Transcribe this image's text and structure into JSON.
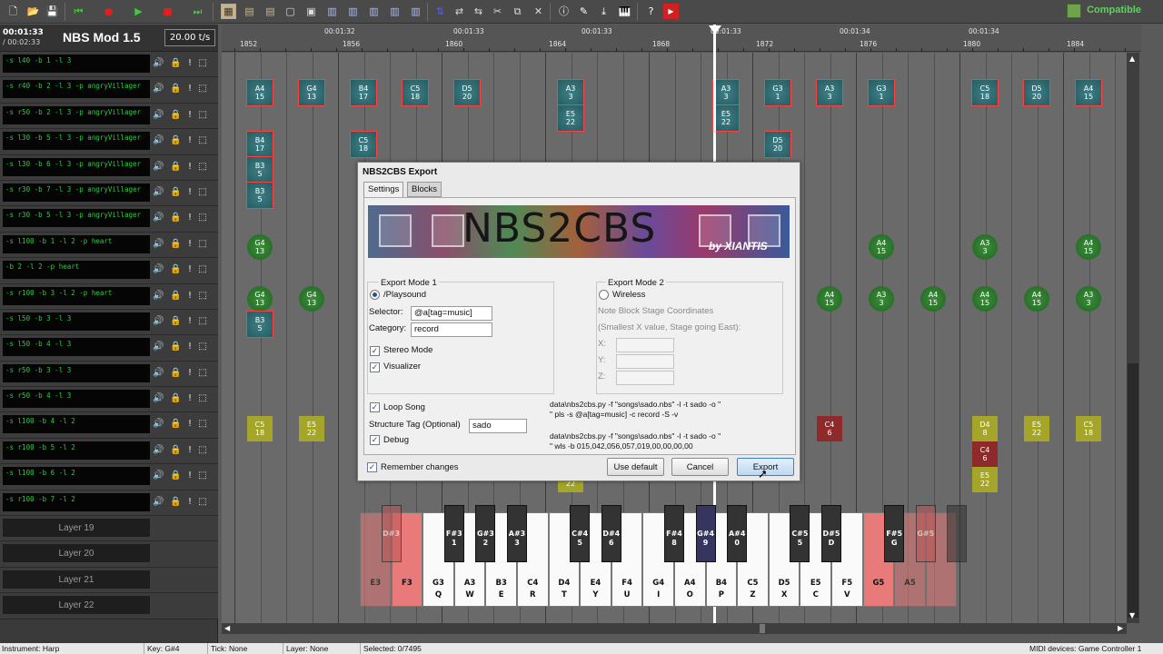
{
  "app": {
    "compatibility": "Compatible"
  },
  "toolbar": {
    "buttons": [
      "new-file",
      "open-file",
      "save-file",
      "skip-back",
      "record",
      "play",
      "stop",
      "skip-forward",
      "select-all",
      "select-left",
      "select-right",
      "select-none",
      "clear",
      "invert",
      "cut-copy",
      "paste",
      "transpose",
      "expand",
      "compress",
      "cut",
      "copy",
      "delete",
      "info",
      "edit",
      "export-midi",
      "piano",
      "help",
      "youtube"
    ]
  },
  "song": {
    "current_time": "00:01:33",
    "total_time": "/ 00:02:33",
    "title": "NBS Mod 1.5",
    "tempo": "20.00 t/s"
  },
  "layers": [
    {
      "name": "-s l40 -b 1 -l 3"
    },
    {
      "name": "-s r40 -b 2 -l 3 -p angryVillager"
    },
    {
      "name": "-s r50 -b 2 -l 3 -p angryVillager"
    },
    {
      "name": "-s l30 -b 5 -l 3 -p angryVillager"
    },
    {
      "name": "-s l30 -b 6 -l 3 -p angryVillager"
    },
    {
      "name": "-s r30 -b 7 -l 3 -p angryVillager"
    },
    {
      "name": "-s r30 -b 5 -l 3 -p angryVillager"
    },
    {
      "name": "-s l100 -b 1 -l 2 -p heart"
    },
    {
      "name": "-b 2 -l 2 -p heart"
    },
    {
      "name": "-s r100 -b 3 -l 2 -p heart"
    },
    {
      "name": "-s l50 -b 3 -l 3"
    },
    {
      "name": "-s l50 -b 4 -l 3"
    },
    {
      "name": "-s r50 -b 3 -l 3"
    },
    {
      "name": "-s r50 -b 4 -l 3"
    },
    {
      "name": "-s l100 -b 4 -l 2"
    },
    {
      "name": "-s r100 -b 5 -l 2"
    },
    {
      "name": "-s l100 -b 6 -l 2"
    },
    {
      "name": "-s r100 -b 7 -l 2"
    },
    {
      "name": "Layer 19"
    },
    {
      "name": "Layer 20"
    },
    {
      "name": "Layer 21"
    },
    {
      "name": "Layer 22"
    }
  ],
  "ruler": {
    "times": [
      "00:01:32",
      "00:01:33",
      "00:01:33",
      "00:01:33",
      "00:01:34",
      "00:01:34"
    ],
    "ticks": [
      "1852",
      "1856",
      "1860",
      "1864",
      "1868",
      "1872",
      "1876",
      "1880",
      "1884"
    ]
  },
  "notes": [
    {
      "label": "A4",
      "num": "15",
      "style": "teal"
    },
    {
      "label": "G4",
      "num": "13",
      "style": "teal"
    },
    {
      "label": "B4",
      "num": "17",
      "style": "teal"
    },
    {
      "label": "C5",
      "num": "18",
      "style": "teal"
    },
    {
      "label": "D5",
      "num": "20",
      "style": "teal"
    },
    {
      "label": "A3",
      "num": "3",
      "style": "teal"
    },
    {
      "label": "A3",
      "num": "3",
      "style": "teal"
    },
    {
      "label": "G3",
      "num": "1",
      "style": "teal"
    },
    {
      "label": "A3",
      "num": "3",
      "style": "teal"
    },
    {
      "label": "G3",
      "num": "1",
      "style": "teal"
    },
    {
      "label": "C5",
      "num": "18",
      "style": "teal"
    },
    {
      "label": "D5",
      "num": "20",
      "style": "teal"
    },
    {
      "label": "A4",
      "num": "15",
      "style": "teal"
    },
    {
      "label": "E5",
      "num": "22",
      "style": "teal"
    },
    {
      "label": "E5",
      "num": "22",
      "style": "teal"
    },
    {
      "label": "B4",
      "num": "17",
      "style": "teal"
    },
    {
      "label": "C5",
      "num": "18",
      "style": "teal"
    },
    {
      "label": "D5",
      "num": "20",
      "style": "teal"
    },
    {
      "label": "B3",
      "num": "5",
      "style": "teal"
    },
    {
      "label": "B3",
      "num": "5",
      "style": "teal"
    },
    {
      "label": "G4",
      "num": "13",
      "style": "green"
    },
    {
      "label": "A4",
      "num": "15",
      "style": "green"
    },
    {
      "label": "A3",
      "num": "3",
      "style": "green"
    },
    {
      "label": "A4",
      "num": "15",
      "style": "green"
    },
    {
      "label": "G4",
      "num": "13",
      "style": "green"
    },
    {
      "label": "G4",
      "num": "13",
      "style": "green"
    },
    {
      "label": "A4",
      "num": "15",
      "style": "green"
    },
    {
      "label": "A3",
      "num": "3",
      "style": "green"
    },
    {
      "label": "A4",
      "num": "15",
      "style": "green"
    },
    {
      "label": "A4",
      "num": "15",
      "style": "green"
    },
    {
      "label": "A4",
      "num": "15",
      "style": "green"
    },
    {
      "label": "A3",
      "num": "3",
      "style": "green"
    },
    {
      "label": "B3",
      "num": "5",
      "style": "teal"
    },
    {
      "label": "C5",
      "num": "18",
      "style": "gold"
    },
    {
      "label": "E5",
      "num": "22",
      "style": "gold"
    },
    {
      "label": "C4",
      "num": "6",
      "style": "red"
    },
    {
      "label": "D4",
      "num": "8",
      "style": "gold"
    },
    {
      "label": "E5",
      "num": "22",
      "style": "gold"
    },
    {
      "label": "C5",
      "num": "18",
      "style": "gold"
    },
    {
      "label": "C4",
      "num": "6",
      "style": "red"
    },
    {
      "label": "E5",
      "num": "22",
      "style": "gold"
    },
    {
      "label": "E5",
      "num": "22",
      "style": "gold"
    }
  ],
  "piano": {
    "white_keys": [
      {
        "note": "E3",
        "key": "",
        "state": "pink-dim"
      },
      {
        "note": "F3",
        "key": "",
        "state": "pink"
      },
      {
        "note": "G3",
        "key": "Q",
        "state": ""
      },
      {
        "note": "A3",
        "key": "W",
        "state": ""
      },
      {
        "note": "B3",
        "key": "E",
        "state": ""
      },
      {
        "note": "C4",
        "key": "R",
        "state": ""
      },
      {
        "note": "D4",
        "key": "T",
        "state": ""
      },
      {
        "note": "E4",
        "key": "Y",
        "state": ""
      },
      {
        "note": "F4",
        "key": "U",
        "state": ""
      },
      {
        "note": "G4",
        "key": "I",
        "state": ""
      },
      {
        "note": "A4",
        "key": "O",
        "state": ""
      },
      {
        "note": "B4",
        "key": "P",
        "state": ""
      },
      {
        "note": "C5",
        "key": "Z",
        "state": ""
      },
      {
        "note": "D5",
        "key": "X",
        "state": ""
      },
      {
        "note": "E5",
        "key": "C",
        "state": ""
      },
      {
        "note": "F5",
        "key": "V",
        "state": ""
      },
      {
        "note": "G5",
        "key": "",
        "state": "pink"
      },
      {
        "note": "A5",
        "key": "",
        "state": "pink-dim"
      },
      {
        "note": "",
        "key": "",
        "state": "pink-dim"
      }
    ],
    "black_keys": [
      {
        "note": "D#3",
        "key": "",
        "state": "pink-dim"
      },
      {
        "note": "F#3",
        "key": "1",
        "state": ""
      },
      {
        "note": "G#3",
        "key": "2",
        "state": ""
      },
      {
        "note": "A#3",
        "key": "3",
        "state": ""
      },
      {
        "note": "C#4",
        "key": "5",
        "state": ""
      },
      {
        "note": "D#4",
        "key": "6",
        "state": ""
      },
      {
        "note": "F#4",
        "key": "8",
        "state": ""
      },
      {
        "note": "G#4",
        "key": "9",
        "state": "sel"
      },
      {
        "note": "A#4",
        "key": "0",
        "state": ""
      },
      {
        "note": "C#5",
        "key": "5",
        "state": ""
      },
      {
        "note": "D#5",
        "key": "D",
        "state": ""
      },
      {
        "note": "F#5",
        "key": "G",
        "state": ""
      },
      {
        "note": "G#5",
        "key": "",
        "state": "pink-dim"
      },
      {
        "note": "",
        "key": "",
        "state": "dim"
      }
    ]
  },
  "dialog": {
    "title": "NBS2CBS Export",
    "tabs": [
      "Settings",
      "Blocks"
    ],
    "banner_title": "NBS2CBS",
    "banner_by": "by XIANTIS",
    "mode1": {
      "title": "Export Mode 1",
      "radio_label": "/Playsound",
      "selector_label": "Selector:",
      "selector_value": "@a[tag=music]",
      "category_label": "Category:",
      "category_value": "record",
      "stereo_label": "Stereo Mode",
      "visualizer_label": "Visualizer"
    },
    "mode2": {
      "title": "Export Mode 2",
      "radio_label": "Wireless",
      "coords_label": "Note Block Stage Coordinates",
      "coords_hint": "(Smallest X value, Stage going East):",
      "x_label": "X:",
      "y_label": "Y:",
      "z_label": "Z:"
    },
    "loop_label": "Loop Song",
    "structure_label": "Structure Tag (Optional)",
    "structure_value": "sado",
    "debug_label": "Debug",
    "cmd1": "data\\nbs2cbs.py -f \"songs\\sado.nbs\" -l -t sado -o \"\n\" pls -s @a[tag=music] -c record -S -v",
    "cmd2": "data\\nbs2cbs.py -f \"songs\\sado.nbs\" -l -t sado -o \"\n\" wls -b 015,042,056,057,019,00,00,00,00",
    "remember_label": "Remember changes",
    "use_default": "Use default",
    "cancel": "Cancel",
    "export": "Export"
  },
  "status": {
    "instrument": "Instrument: Harp",
    "key": "Key: G#4",
    "tick": "Tick: None",
    "layer": "Layer: None",
    "selected": "Selected: 0/7495",
    "midi": "MIDI devices: Game Controller 1"
  }
}
